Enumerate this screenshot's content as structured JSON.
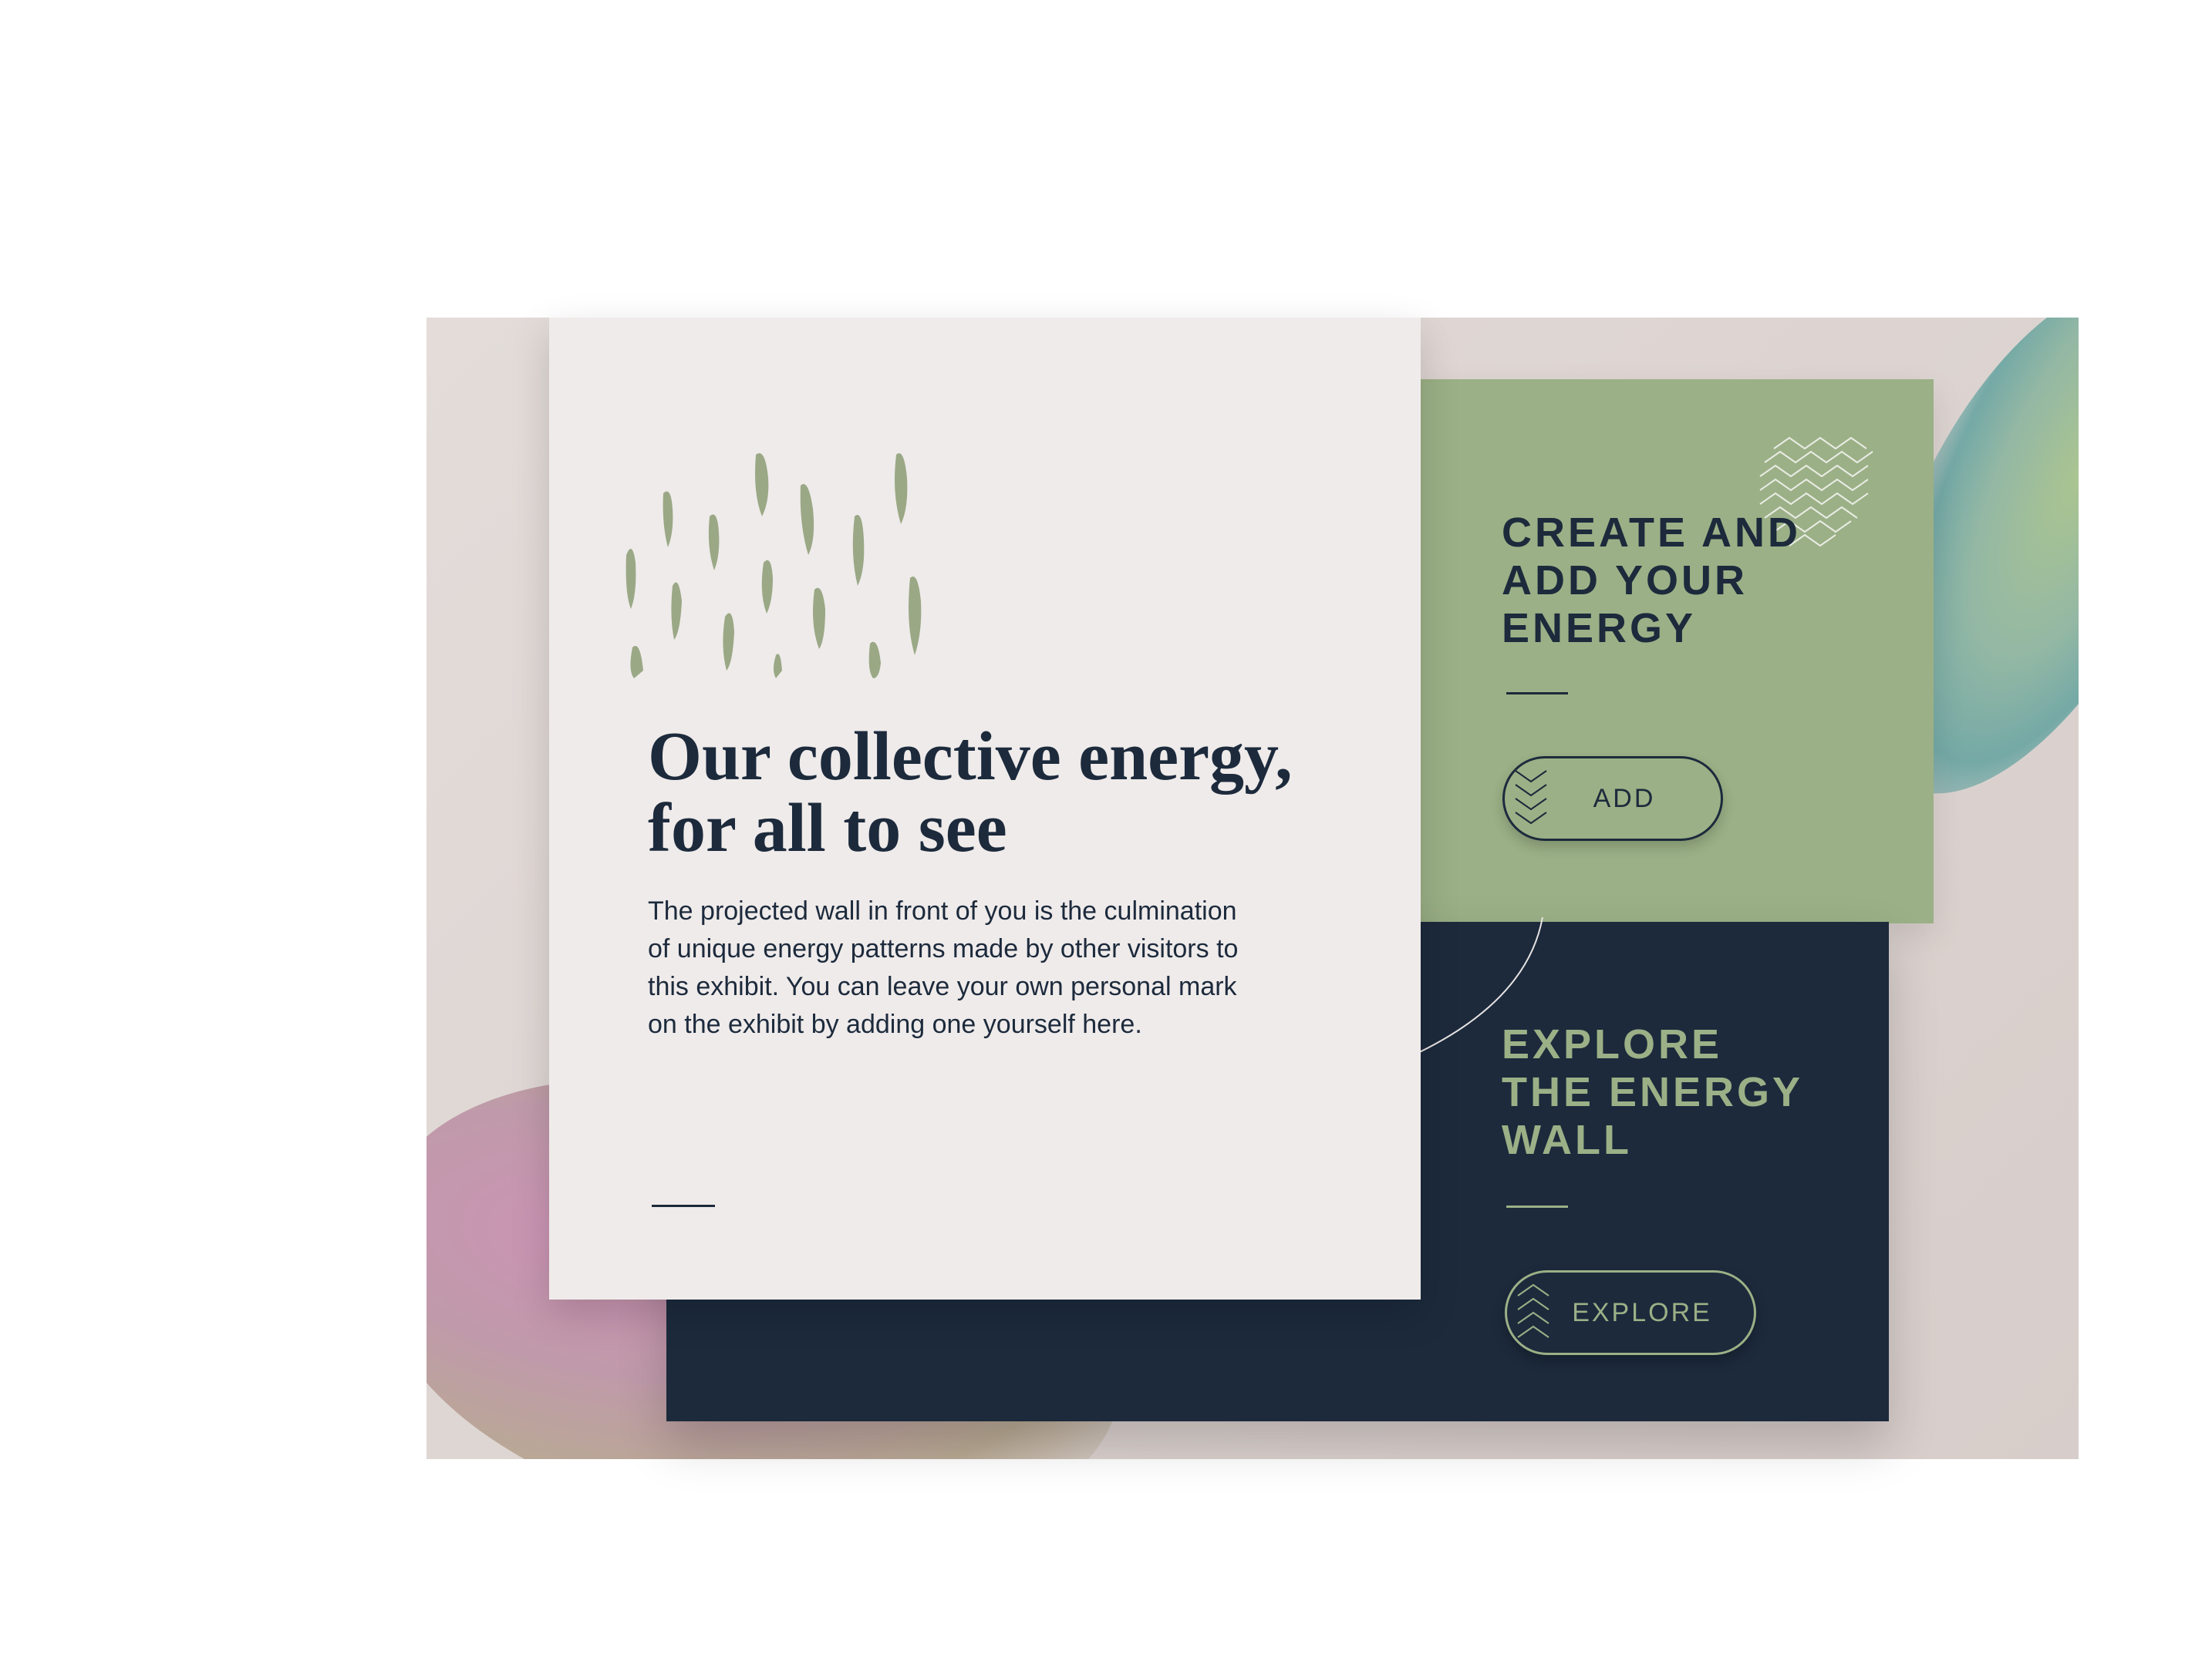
{
  "hero": {
    "headline": "Our collective energy, for all to see",
    "body": "The projected wall in front of you is the culmination of unique energy patterns made by other visitors to this exhibit. You can leave your own personal mark on the exhibit by adding one yourself here."
  },
  "create": {
    "title": "CREATE AND ADD YOUR ENERGY",
    "button_label": "ADD"
  },
  "explore": {
    "title": "EXPLORE THE ENERGY WALL",
    "button_label": "EXPLORE"
  },
  "icons": {
    "brush_strokes": "brush-strokes-icon",
    "zigzag": "zigzag-pattern-icon",
    "chevrons": "chevron-pattern-icon"
  },
  "colors": {
    "navy": "#1c2a3c",
    "sage": "#9bb086",
    "paper": "#efebea",
    "backdrop": "#ddd5d2"
  }
}
